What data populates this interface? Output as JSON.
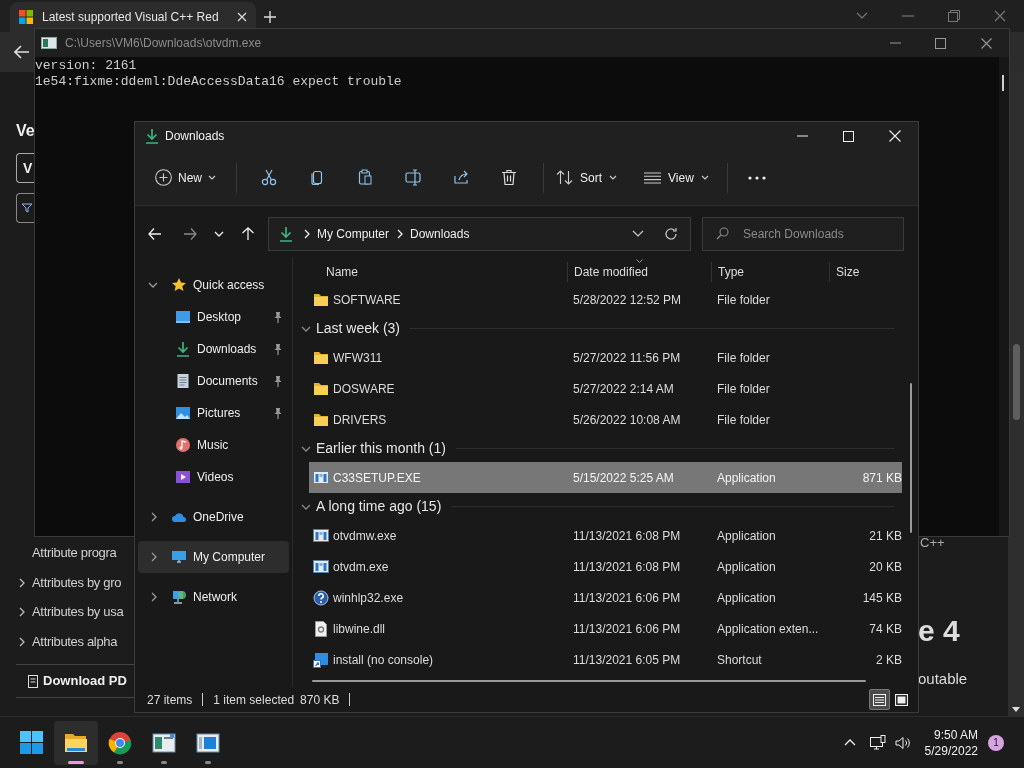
{
  "browser": {
    "tab": {
      "title": "Latest supported Visual C++ Red"
    },
    "page": {
      "heading": "Ve",
      "button_label": "V",
      "links": [
        {
          "label": "Attribute progra",
          "expandable": false
        },
        {
          "label": "Attributes by gro",
          "expandable": true
        },
        {
          "label": "Attributes by usa",
          "expandable": true
        },
        {
          "label": "Attributes alpha",
          "expandable": true
        }
      ],
      "download_label": "Download PD",
      "side_note": "C++",
      "side_heading": "e 4",
      "side_text": "outable"
    }
  },
  "console": {
    "title": "C:\\Users\\VM6\\Downloads\\otvdm.exe",
    "lines": [
      "version: 2161",
      "1e54:fixme:ddeml:DdeAccessData16 expect trouble"
    ]
  },
  "explorer": {
    "title": "Downloads",
    "toolbar": {
      "new": "New",
      "sort": "Sort",
      "view": "View"
    },
    "address": {
      "crumbs": [
        "My Computer",
        "Downloads"
      ]
    },
    "search": {
      "placeholder": "Search Downloads"
    },
    "nav": [
      {
        "label": "Quick access",
        "kind": "star",
        "expanded": true,
        "selected": false,
        "children": [
          {
            "label": "Desktop",
            "kind": "desktop",
            "pinned": true,
            "selected": false
          },
          {
            "label": "Downloads",
            "kind": "download",
            "pinned": true,
            "selected": false
          },
          {
            "label": "Documents",
            "kind": "documents",
            "pinned": true,
            "selected": false
          },
          {
            "label": "Pictures",
            "kind": "pictures",
            "pinned": true,
            "selected": false
          },
          {
            "label": "Music",
            "kind": "music",
            "pinned": false,
            "selected": false
          },
          {
            "label": "Videos",
            "kind": "videos",
            "pinned": false,
            "selected": false
          }
        ]
      },
      {
        "label": "OneDrive",
        "kind": "cloud",
        "expanded": false,
        "selected": false
      },
      {
        "label": "My Computer",
        "kind": "computer",
        "expanded": false,
        "selected": true
      },
      {
        "label": "Network",
        "kind": "network",
        "expanded": false,
        "selected": false
      }
    ],
    "columns": [
      "Name",
      "Date modified",
      "Type",
      "Size"
    ],
    "items": [
      {
        "kind": "folder",
        "name": "SOFTWARE",
        "date": "5/28/2022 12:52 PM",
        "type": "File folder",
        "selected": false
      },
      {
        "kind": "group",
        "name": "Last week (3)",
        "expanded": true
      },
      {
        "kind": "folder",
        "name": "WFW311",
        "date": "5/27/2022 11:56 PM",
        "type": "File folder",
        "selected": false
      },
      {
        "kind": "folder",
        "name": "DOSWARE",
        "date": "5/27/2022 2:14 AM",
        "type": "File folder",
        "selected": false
      },
      {
        "kind": "folder",
        "name": "DRIVERS",
        "date": "5/26/2022 10:08 AM",
        "type": "File folder",
        "selected": false
      },
      {
        "kind": "group",
        "name": "Earlier this month (1)",
        "expanded": true
      },
      {
        "kind": "app",
        "name": "C33SETUP.EXE",
        "date": "5/15/2022 5:25 AM",
        "type": "Application",
        "size": "871 KB",
        "selected": true
      },
      {
        "kind": "group",
        "name": "A long time ago (15)",
        "expanded": true
      },
      {
        "kind": "app",
        "name": "otvdmw.exe",
        "date": "11/13/2021 6:08 PM",
        "type": "Application",
        "size": "21 KB",
        "selected": false
      },
      {
        "kind": "app",
        "name": "otvdm.exe",
        "date": "11/13/2021 6:08 PM",
        "type": "Application",
        "size": "20 KB",
        "selected": false
      },
      {
        "kind": "help",
        "name": "winhlp32.exe",
        "date": "11/13/2021 6:06 PM",
        "type": "Application",
        "size": "145 KB",
        "selected": false
      },
      {
        "kind": "dll",
        "name": "libwine.dll",
        "date": "11/13/2021 6:06 PM",
        "type": "Application exten...",
        "size": "74 KB",
        "selected": false
      },
      {
        "kind": "shortcut",
        "name": "install (no console)",
        "date": "11/13/2021 6:05 PM",
        "type": "Shortcut",
        "size": "2 KB",
        "selected": false
      }
    ],
    "status": {
      "count": "27 items",
      "selection": "1 item selected",
      "size": "870 KB"
    },
    "views": [
      {
        "kind": "details",
        "selected": true
      },
      {
        "kind": "large",
        "selected": false
      }
    ]
  },
  "taskbar": {
    "apps": [
      {
        "kind": "start",
        "active": false,
        "running": false
      },
      {
        "kind": "explorer",
        "active": true,
        "running": true
      },
      {
        "kind": "browser",
        "active": false,
        "running": true
      },
      {
        "kind": "app",
        "active": false,
        "running": true
      },
      {
        "kind": "window",
        "active": false,
        "running": true
      }
    ],
    "time": "9:50 AM",
    "date": "5/29/2022",
    "notifications": "1"
  }
}
